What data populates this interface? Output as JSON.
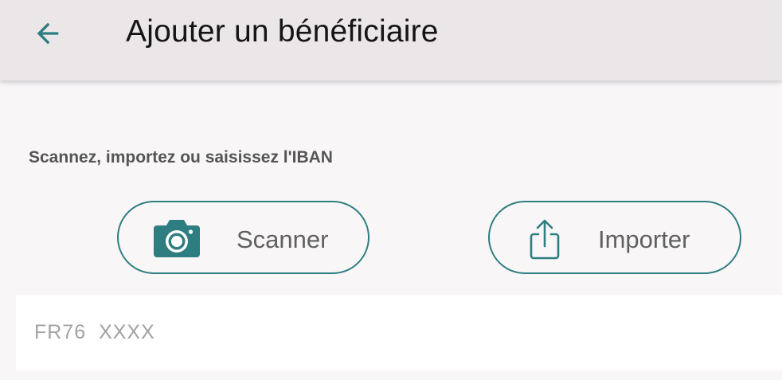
{
  "header": {
    "title": "Ajouter un bénéficiaire",
    "back_icon": "arrow-left-icon"
  },
  "main": {
    "instructions": "Scannez, importez ou saisissez l'IBAN",
    "scan_button": {
      "label": "Scanner",
      "icon": "camera-icon"
    },
    "import_button": {
      "label": "Importer",
      "icon": "share-upload-icon"
    },
    "iban_input": {
      "value": "",
      "placeholder": "FR76 XXXX"
    }
  },
  "colors": {
    "accent": "#2e7d80",
    "appbar_background": "#ebe6e7",
    "page_background": "#f8f6f7",
    "title_text": "#151515",
    "instruction_text": "#555555",
    "button_text": "#606060",
    "placeholder_text": "#a2a2a2"
  }
}
